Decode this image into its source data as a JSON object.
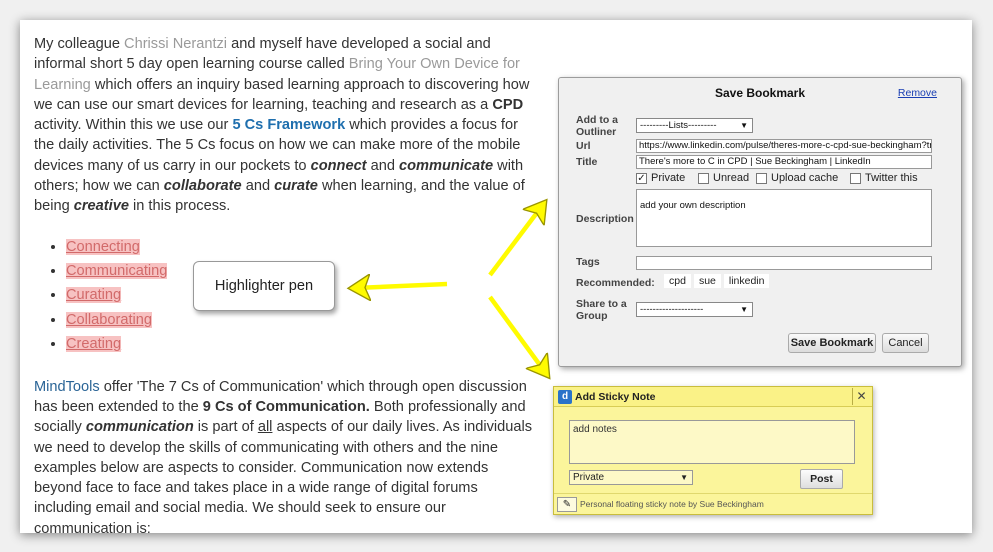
{
  "article": {
    "p1": {
      "t1": "My colleague ",
      "link_chrissi": "Chrissi Nerantzi",
      "t2": " and myself have developed a social and informal short 5 day open learning course called ",
      "link_byod": "Bring Your Own Device for Learning",
      "t3": " which offers an inquiry based learning approach to discovering how we can use our smart devices for learning, teaching and research as a ",
      "cpd": "CPD",
      "t4": " activity. Within this we use our ",
      "link_5cs": "5 Cs Framework",
      "t5": " which provides a focus for the daily activities. The 5 Cs focus on how we can make more of the mobile devices many of us carry in our pockets to ",
      "connect": "connect",
      "t6": " and ",
      "communicate": "communicate",
      "t7": " with others; how we can ",
      "collaborate": "collaborate",
      "t8": " and ",
      "curate": "curate",
      "t9": " when learning, and the value of being ",
      "creative": "creative",
      "t10": " in this process."
    },
    "cs_list": [
      "Connecting",
      "Communicating",
      "Curating",
      "Collaborating",
      "Creating"
    ],
    "p2": {
      "link_mindtools": "MindTools",
      "t1": " offer 'The 7 Cs of Communication' which through open discussion has been extended to the ",
      "nine_cs": "9 Cs of Communication.",
      "t2": " Both professionally and socially ",
      "communication": "communication",
      "t3": " is part of ",
      "all": "all",
      "t4": " aspects of our daily lives. As individuals we need to develop the skills of communicating with others and the nine examples below are aspects to consider. Communication now extends beyond face to face and takes place in a wide range of digital forums including email and social media. We should seek to ensure our communication is:"
    }
  },
  "callout": {
    "label": "Highlighter pen"
  },
  "bookmark": {
    "title": "Save Bookmark",
    "remove": "Remove",
    "add_outliner_label": "Add to a Outliner",
    "lists_value": "---------Lists---------",
    "url_label": "Url",
    "url_value": "https://www.linkedin.com/pulse/theres-more-c-cpd-sue-beckingham?trk=",
    "title_label": "Title",
    "title_value": "There's more to C in CPD | Sue Beckingham | LinkedIn",
    "checkboxes": [
      {
        "label": "Private",
        "checked": true
      },
      {
        "label": "Unread",
        "checked": false
      },
      {
        "label": "Upload cache",
        "checked": false
      },
      {
        "label": "Twitter this",
        "checked": false
      }
    ],
    "description_label": "Description",
    "description_value": "add your own description",
    "tags_label": "Tags",
    "recommended_label": "Recommended:",
    "recommended": [
      "cpd",
      "sue",
      "linkedin"
    ],
    "share_label": "Share to a Group",
    "share_value": "--------------------",
    "save_button": "Save Bookmark",
    "cancel_button": "Cancel"
  },
  "sticky": {
    "logo": "d",
    "title": "Add Sticky Note",
    "close": "✕",
    "notes_value": "add notes",
    "privacy_value": "Private",
    "post_button": "Post",
    "footer": "Personal floating sticky note by Sue Beckingham"
  },
  "colors": {
    "link_grey": "#9a9a9a",
    "link_blue": "#2a6496",
    "highlight": "#f7c2c2",
    "arrow": "#fffb00",
    "sticky_bg": "#fbf59b"
  }
}
